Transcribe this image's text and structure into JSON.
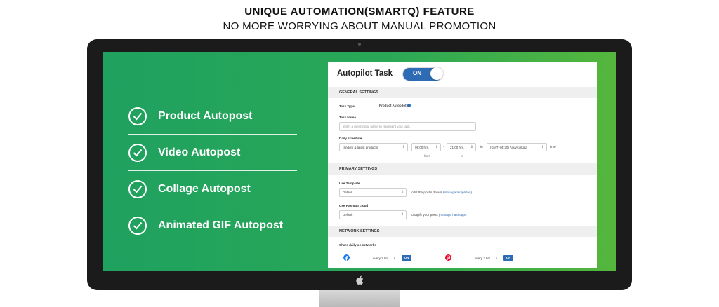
{
  "headline": {
    "title": "UNIQUE AUTOMATION(SMARTQ) FEATURE",
    "subtitle": "NO MORE WORRYING ABOUT MANUAL PROMOTION"
  },
  "features": [
    {
      "label": "Product Autopost",
      "icon": "check-circle-icon"
    },
    {
      "label": "Video Autopost",
      "icon": "check-circle-icon"
    },
    {
      "label": "Collage Autopost",
      "icon": "check-circle-icon"
    },
    {
      "label": "Animated GIF Autopost",
      "icon": "check-circle-icon"
    }
  ],
  "panel": {
    "title": "Autopilot Task",
    "toggle": "ON",
    "general": {
      "heading": "GENERAL SETTINGS",
      "task_type_label": "Task Type",
      "task_type_value": "Product Autopilot",
      "task_name_label": "Task Name",
      "task_name_placeholder": "enter a meaningful name to represent your task.",
      "schedule_label": "Daily schedule",
      "schedule_mode": "random & latest products",
      "from_time": "09:00 hrs.",
      "dash": "-",
      "to_time": "21:00 hrs.",
      "in": "in",
      "timezone": "(GMT+05:30) Asia/Kolkata",
      "time_suffix": "time",
      "from_label": "from",
      "to_label": "to"
    },
    "primary": {
      "heading": "PRIMARY SETTINGS",
      "template_label": "Use Template",
      "template_value": "Default",
      "template_note": "to fill the post's details (",
      "template_link": "manage templates",
      "template_note_end": ")",
      "hashtag_label": "Use Hashtag cloud",
      "hashtag_value": "Default",
      "hashtag_note": "to tagify your posts (",
      "hashtag_link": "manage hashtags",
      "hashtag_note_end": ")"
    },
    "network": {
      "heading": "NETWORK SETTINGS",
      "share_label": "Share daily on networks",
      "items": [
        {
          "network": "facebook",
          "icon": "facebook-icon",
          "color": "#1877f2",
          "frequency": "every 2 hrs",
          "status": "ON"
        },
        {
          "network": "pinterest",
          "icon": "pinterest-icon",
          "color": "#e60023",
          "frequency": "every 2 hrs",
          "status": "ON"
        }
      ]
    }
  },
  "colors": {
    "accent": "#2d6bb4",
    "screen_gradient_start": "#1fa15f",
    "screen_gradient_end": "#55b63c"
  }
}
